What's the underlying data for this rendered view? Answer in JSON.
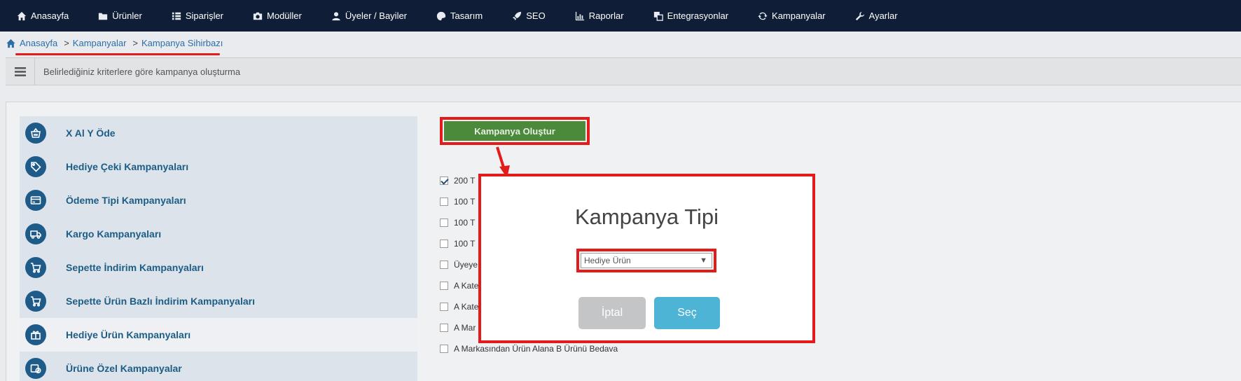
{
  "nav": {
    "items": [
      {
        "label": "Anasayfa",
        "icon": "home-icon"
      },
      {
        "label": "Ürünler",
        "icon": "folder-icon"
      },
      {
        "label": "Siparişler",
        "icon": "list-icon"
      },
      {
        "label": "Modüller",
        "icon": "module-icon"
      },
      {
        "label": "Üyeler / Bayiler",
        "icon": "user-icon"
      },
      {
        "label": "Tasarım",
        "icon": "palette-icon"
      },
      {
        "label": "SEO",
        "icon": "rocket-icon"
      },
      {
        "label": "Raporlar",
        "icon": "chart-icon"
      },
      {
        "label": "Entegrasyonlar",
        "icon": "integration-icon"
      },
      {
        "label": "Kampanyalar",
        "icon": "refresh-icon"
      },
      {
        "label": "Ayarlar",
        "icon": "wrench-icon"
      }
    ]
  },
  "breadcrumb": {
    "home": "Anasayfa",
    "sep": ">",
    "level1": "Kampanyalar",
    "level2": "Kampanya Sihirbazı"
  },
  "infobar": {
    "text": "Belirlediğiniz kriterlere göre kampanya oluşturma"
  },
  "campaigns": {
    "items": [
      {
        "label": "X Al Y Öde",
        "icon": "basket-icon"
      },
      {
        "label": "Hediye Çeki Kampanyaları",
        "icon": "tag-icon"
      },
      {
        "label": "Ödeme Tipi Kampanyaları",
        "icon": "credit-card-icon"
      },
      {
        "label": "Kargo Kampanyaları",
        "icon": "truck-icon"
      },
      {
        "label": "Sepette İndirim Kampanyaları",
        "icon": "cart-icon"
      },
      {
        "label": "Sepette Ürün Bazlı İndirim Kampanyaları",
        "icon": "cart-icon"
      },
      {
        "label": "Hediye Ürün Kampanyaları",
        "icon": "gift-icon"
      },
      {
        "label": "Ürüne Özel Kampanyalar",
        "icon": "product-badge-icon"
      }
    ],
    "active_index": 6
  },
  "create_button": {
    "label": "Kampanya Oluştur"
  },
  "checklist": {
    "items": [
      {
        "label": "200 T",
        "checked": true
      },
      {
        "label": "100 T",
        "checked": false
      },
      {
        "label": "100 T",
        "checked": false
      },
      {
        "label": "100 T",
        "checked": false
      },
      {
        "label": "Üyeye",
        "checked": false
      },
      {
        "label": "A Kate",
        "checked": false
      },
      {
        "label": "A Kate",
        "checked": false
      },
      {
        "label": "A Mar",
        "checked": false
      },
      {
        "label": "A Markasından Ürün Alana B Ürünü Bedava",
        "checked": false
      }
    ]
  },
  "modal": {
    "title": "Kampanya Tipi",
    "select_value": "Hediye Ürün",
    "cancel_label": "İptal",
    "select_label": "Seç"
  },
  "colors": {
    "nav_bg": "#0f1e36",
    "accent_green": "#4a8a3a",
    "accent_blue": "#4db4d6",
    "highlight_red": "#e31b1b",
    "campaign_icon": "#1e5b88"
  }
}
